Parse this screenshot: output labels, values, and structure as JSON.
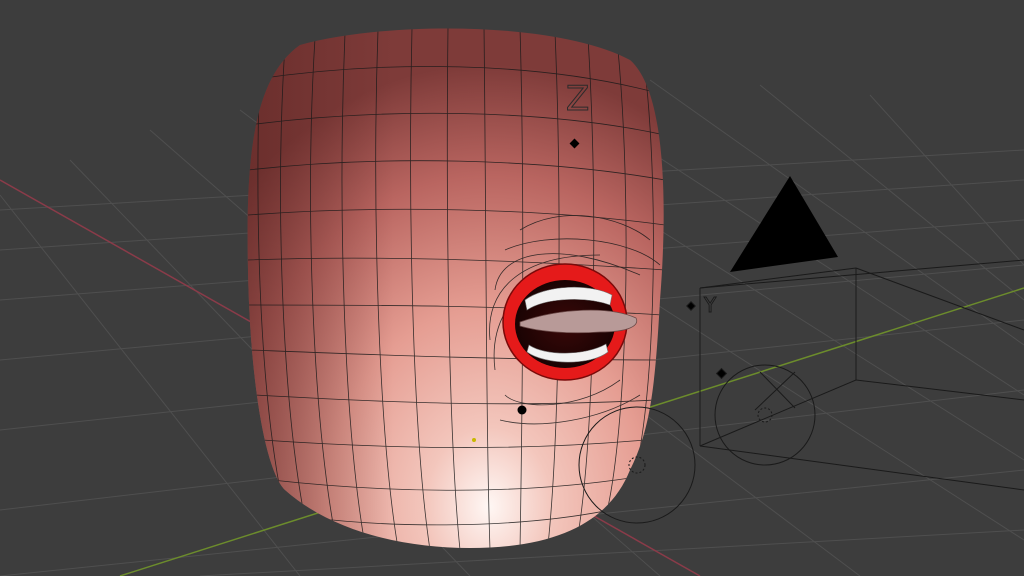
{
  "viewport": {
    "mode": "3D viewport",
    "background": "#3d3d3d",
    "grid_color": "#4f4f4f",
    "x_axis_color": "#8a3b49",
    "y_axis_color": "#6c8c2c"
  },
  "scene": {
    "object": "head-mesh",
    "skin_color": "#e8a79c",
    "lip_color": "#e51a1a",
    "wire_color": "#1a1a1a",
    "camera_up_label": "Y",
    "gizmo_label": "Z"
  }
}
